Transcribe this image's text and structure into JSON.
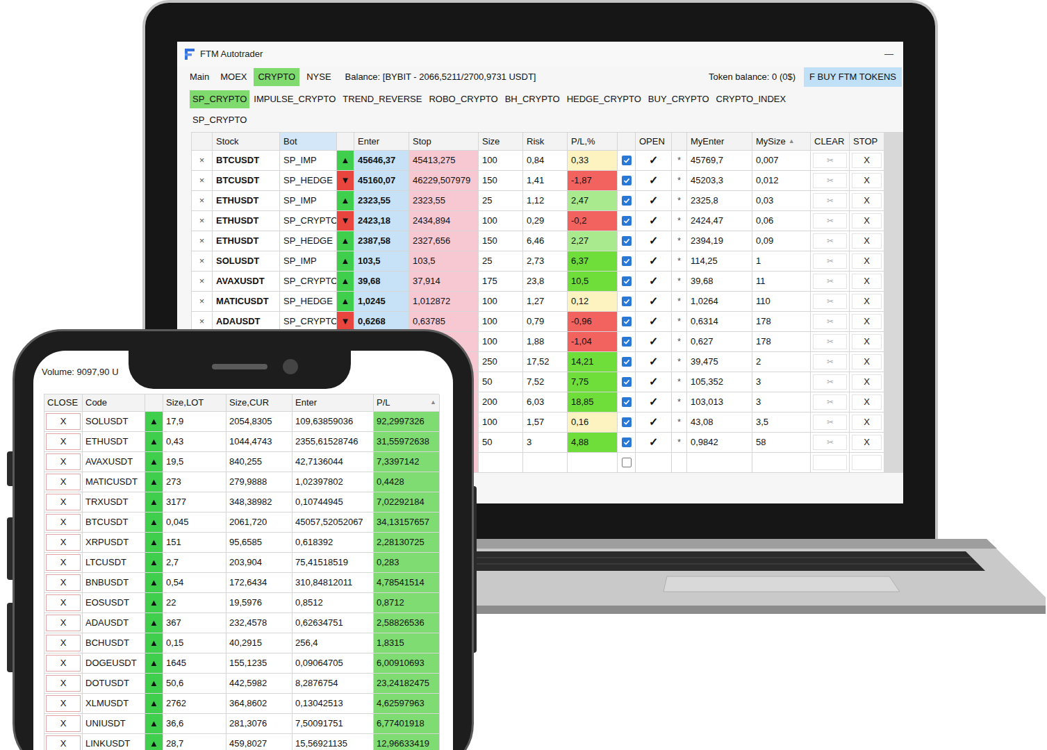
{
  "window": {
    "title": "FTM Autotrader",
    "minimize": "—"
  },
  "menu": [
    {
      "label": "Main",
      "selected": false
    },
    {
      "label": "MOEX",
      "selected": false
    },
    {
      "label": "CRYPTO",
      "selected": true
    },
    {
      "label": "NYSE",
      "selected": false
    }
  ],
  "balance": "Balance: [BYBIT - 2066,5211/2700,9731 USDT]",
  "token_balance": "Token balance: 0 (0$)",
  "buy_button": "F BUY FTM TOKENS",
  "sub_tabs": [
    {
      "label": "SP_CRYPTO",
      "selected": true
    },
    {
      "label": "IMPULSE_CRYPTO",
      "selected": false
    },
    {
      "label": "TREND_REVERSE",
      "selected": false
    },
    {
      "label": "ROBO_CRYPTO",
      "selected": false
    },
    {
      "label": "BH_CRYPTO",
      "selected": false
    },
    {
      "label": "HEDGE_CRYPTO",
      "selected": false
    },
    {
      "label": "BUY_CRYPTO",
      "selected": false
    },
    {
      "label": "CRYPTO_INDEX",
      "selected": false
    }
  ],
  "section_label": "SP_CRYPTO",
  "table": {
    "columns": [
      {
        "label": "",
        "sort": ""
      },
      {
        "label": "Stock",
        "sort": ""
      },
      {
        "label": "Bot",
        "sort": ""
      },
      {
        "label": "",
        "sort": ""
      },
      {
        "label": "Enter",
        "sort": ""
      },
      {
        "label": "Stop",
        "sort": ""
      },
      {
        "label": "Size",
        "sort": ""
      },
      {
        "label": "Risk",
        "sort": ""
      },
      {
        "label": "P/L,%",
        "sort": ""
      },
      {
        "label": "",
        "sort": ""
      },
      {
        "label": "OPEN",
        "sort": ""
      },
      {
        "label": "",
        "sort": ""
      },
      {
        "label": "MyEnter",
        "sort": ""
      },
      {
        "label": "MySize",
        "sort": "▲"
      },
      {
        "label": "CLEAR",
        "sort": ""
      },
      {
        "label": "STOP",
        "sort": ""
      }
    ],
    "rows": [
      {
        "remove": "×",
        "stock": "BTCUSDT",
        "bot": "SP_IMP",
        "arrow": "▲",
        "arrow_color": "#3fcf4c",
        "enter": "45646,37",
        "stop": "45413,275",
        "size": "100",
        "risk": "0,84",
        "pl": "0,33",
        "pl_color": "#fcf3c0",
        "checked": true,
        "open": "✓",
        "star": "*",
        "my_enter": "45769,7",
        "my_size": "0,007",
        "clear": "✂",
        "stop_button": "X"
      },
      {
        "remove": "×",
        "stock": "BTCUSDT",
        "bot": "SP_HEDGE",
        "arrow": "▼",
        "arrow_color": "#e8453f",
        "enter": "45160,07",
        "stop": "46229,507979",
        "size": "150",
        "risk": "1,41",
        "pl": "-1,87",
        "pl_color": "#f2625f",
        "checked": true,
        "open": "✓",
        "star": "*",
        "my_enter": "45203,3",
        "my_size": "0,012",
        "clear": "✂",
        "stop_button": "X"
      },
      {
        "remove": "×",
        "stock": "ETHUSDT",
        "bot": "SP_IMP",
        "arrow": "▲",
        "arrow_color": "#3fcf4c",
        "enter": "2323,55",
        "stop": "2323,55",
        "size": "25",
        "risk": "1,12",
        "pl": "2,47",
        "pl_color": "#a9ea8e",
        "checked": true,
        "open": "✓",
        "star": "*",
        "my_enter": "2325,8",
        "my_size": "0,03",
        "clear": "✂",
        "stop_button": "X"
      },
      {
        "remove": "×",
        "stock": "ETHUSDT",
        "bot": "SP_CRYPTO",
        "arrow": "▼",
        "arrow_color": "#e8453f",
        "enter": "2423,18",
        "stop": "2434,894",
        "size": "100",
        "risk": "0,29",
        "pl": "-0,2",
        "pl_color": "#f2625f",
        "checked": true,
        "open": "✓",
        "star": "*",
        "my_enter": "2424,47",
        "my_size": "0,06",
        "clear": "✂",
        "stop_button": "X"
      },
      {
        "remove": "×",
        "stock": "ETHUSDT",
        "bot": "SP_HEDGE",
        "arrow": "▲",
        "arrow_color": "#3fcf4c",
        "enter": "2387,58",
        "stop": "2327,656",
        "size": "150",
        "risk": "6,46",
        "pl": "2,27",
        "pl_color": "#a9ea8e",
        "checked": true,
        "open": "✓",
        "star": "*",
        "my_enter": "2394,19",
        "my_size": "0,09",
        "clear": "✂",
        "stop_button": "X"
      },
      {
        "remove": "×",
        "stock": "SOLUSDT",
        "bot": "SP_IMP",
        "arrow": "▲",
        "arrow_color": "#3fcf4c",
        "enter": "103,5",
        "stop": "103,5",
        "size": "25",
        "risk": "2,73",
        "pl": "6,37",
        "pl_color": "#6fdd3a",
        "checked": true,
        "open": "✓",
        "star": "*",
        "my_enter": "114,25",
        "my_size": "1",
        "clear": "✂",
        "stop_button": "X"
      },
      {
        "remove": "×",
        "stock": "AVAXUSDT",
        "bot": "SP_CRYPTO",
        "arrow": "▲",
        "arrow_color": "#3fcf4c",
        "enter": "39,68",
        "stop": "37,914",
        "size": "175",
        "risk": "23,8",
        "pl": "10,5",
        "pl_color": "#6fdd3a",
        "checked": true,
        "open": "✓",
        "star": "*",
        "my_enter": "39,68",
        "my_size": "11",
        "clear": "✂",
        "stop_button": "X"
      },
      {
        "remove": "×",
        "stock": "MATICUSDT",
        "bot": "SP_HEDGE",
        "arrow": "▲",
        "arrow_color": "#3fcf4c",
        "enter": "1,0245",
        "stop": "1,012872",
        "size": "100",
        "risk": "1,27",
        "pl": "0,12",
        "pl_color": "#fcf3c0",
        "checked": true,
        "open": "✓",
        "star": "*",
        "my_enter": "1,0264",
        "my_size": "110",
        "clear": "✂",
        "stop_button": "X"
      },
      {
        "remove": "×",
        "stock": "ADAUSDT",
        "bot": "SP_CRYPTO",
        "arrow": "▼",
        "arrow_color": "#e8453f",
        "enter": "0,6268",
        "stop": "0,63785",
        "size": "100",
        "risk": "0,79",
        "pl": "-0,96",
        "pl_color": "#f2625f",
        "checked": true,
        "open": "✓",
        "star": "*",
        "my_enter": "0,6314",
        "my_size": "178",
        "clear": "✂",
        "stop_button": "X"
      },
      {
        "remove": "",
        "stock": "",
        "bot": "",
        "arrow": "",
        "arrow_color": "#ffffff",
        "enter": "",
        "stop": "",
        "size": "100",
        "risk": "1,88",
        "pl": "-1,04",
        "pl_color": "#f2625f",
        "checked": true,
        "open": "✓",
        "star": "*",
        "my_enter": "0,627",
        "my_size": "178",
        "clear": "✂",
        "stop_button": "X"
      },
      {
        "remove": "",
        "stock": "",
        "bot": "",
        "arrow": "",
        "arrow_color": "#ffffff",
        "enter": "",
        "stop": "",
        "size": "250",
        "risk": "17,52",
        "pl": "14,21",
        "pl_color": "#6fdd3a",
        "checked": true,
        "open": "✓",
        "star": "*",
        "my_enter": "39,475",
        "my_size": "2",
        "clear": "✂",
        "stop_button": "X"
      },
      {
        "remove": "",
        "stock": "",
        "bot": "",
        "arrow": "",
        "arrow_color": "#ffffff",
        "enter": "",
        "stop": "",
        "size": "50",
        "risk": "7,52",
        "pl": "7,75",
        "pl_color": "#6fdd3a",
        "checked": true,
        "open": "✓",
        "star": "*",
        "my_enter": "105,352",
        "my_size": "3",
        "clear": "✂",
        "stop_button": "X"
      },
      {
        "remove": "",
        "stock": "",
        "bot": "",
        "arrow": "",
        "arrow_color": "#ffffff",
        "enter": "",
        "stop": "",
        "size": "200",
        "risk": "6,03",
        "pl": "18,85",
        "pl_color": "#6fdd3a",
        "checked": true,
        "open": "✓",
        "star": "*",
        "my_enter": "103,013",
        "my_size": "3",
        "clear": "✂",
        "stop_button": "X"
      },
      {
        "remove": "",
        "stock": "",
        "bot": "",
        "arrow": "",
        "arrow_color": "#ffffff",
        "enter": "",
        "stop": "",
        "size": "100",
        "risk": "1,57",
        "pl": "0,16",
        "pl_color": "#fcf3c0",
        "checked": true,
        "open": "✓",
        "star": "*",
        "my_enter": "43,08",
        "my_size": "3,5",
        "clear": "✂",
        "stop_button": "X"
      },
      {
        "remove": "",
        "stock": "",
        "bot": "",
        "arrow": "",
        "arrow_color": "#ffffff",
        "enter": "",
        "stop": "",
        "size": "50",
        "risk": "3",
        "pl": "4,88",
        "pl_color": "#6fdd3a",
        "checked": true,
        "open": "✓",
        "star": "*",
        "my_enter": "0,9842",
        "my_size": "58",
        "clear": "✂",
        "stop_button": "X"
      },
      {
        "remove": "",
        "stock": "",
        "bot": "",
        "arrow": "",
        "arrow_color": "#ffffff",
        "enter": "",
        "stop": "",
        "size": "",
        "risk": "",
        "pl": "",
        "pl_color": "#ffffff",
        "checked": false,
        "open": "",
        "star": "",
        "my_enter": "",
        "my_size": "",
        "clear": "",
        "stop_button": ""
      }
    ]
  },
  "phone": {
    "volume": "Volume: 9097,90 U",
    "columns": [
      {
        "label": "CLOSE",
        "sort": ""
      },
      {
        "label": "Code",
        "sort": ""
      },
      {
        "label": "",
        "sort": ""
      },
      {
        "label": "Size,LOT",
        "sort": ""
      },
      {
        "label": "Size,CUR",
        "sort": ""
      },
      {
        "label": "Enter",
        "sort": ""
      },
      {
        "label": "P/L",
        "sort": "▲"
      }
    ],
    "rows": [
      {
        "close": "X",
        "code": "SOLUSDT",
        "arrow": "▲",
        "lot": "17,9",
        "cur": "2054,8305",
        "enter": "109,63859036",
        "pl": "92,2997326"
      },
      {
        "close": "X",
        "code": "ETHUSDT",
        "arrow": "▲",
        "lot": "0,43",
        "cur": "1044,4743",
        "enter": "2355,61528746",
        "pl": "31,55972638"
      },
      {
        "close": "X",
        "code": "AVAXUSDT",
        "arrow": "▲",
        "lot": "19,5",
        "cur": "840,255",
        "enter": "42,7136044",
        "pl": "7,3397142"
      },
      {
        "close": "X",
        "code": "MATICUSDT",
        "arrow": "▲",
        "lot": "273",
        "cur": "279,9888",
        "enter": "1,02397802",
        "pl": "0,4428"
      },
      {
        "close": "X",
        "code": "TRXUSDT",
        "arrow": "▲",
        "lot": "3177",
        "cur": "348,38982",
        "enter": "0,10744945",
        "pl": "7,02292184"
      },
      {
        "close": "X",
        "code": "BTCUSDT",
        "arrow": "▲",
        "lot": "0,045",
        "cur": "2061,720",
        "enter": "45057,52052067",
        "pl": "34,13157657"
      },
      {
        "close": "X",
        "code": "XRPUSDT",
        "arrow": "▲",
        "lot": "151",
        "cur": "95,6585",
        "enter": "0,618392",
        "pl": "2,28130725"
      },
      {
        "close": "X",
        "code": "LTCUSDT",
        "arrow": "▲",
        "lot": "2,7",
        "cur": "203,904",
        "enter": "75,41518519",
        "pl": "0,283"
      },
      {
        "close": "X",
        "code": "BNBUSDT",
        "arrow": "▲",
        "lot": "0,54",
        "cur": "172,6434",
        "enter": "310,84812011",
        "pl": "4,78541514"
      },
      {
        "close": "X",
        "code": "EOSUSDT",
        "arrow": "▲",
        "lot": "22",
        "cur": "19,5976",
        "enter": "0,8512",
        "pl": "0,8712"
      },
      {
        "close": "X",
        "code": "ADAUSDT",
        "arrow": "▲",
        "lot": "367",
        "cur": "232,4578",
        "enter": "0,62634751",
        "pl": "2,58826536"
      },
      {
        "close": "X",
        "code": "BCHUSDT",
        "arrow": "▲",
        "lot": "0,15",
        "cur": "40,2915",
        "enter": "256,4",
        "pl": "1,8315"
      },
      {
        "close": "X",
        "code": "DOGEUSDT",
        "arrow": "▲",
        "lot": "1645",
        "cur": "155,1235",
        "enter": "0,09064705",
        "pl": "6,00910693"
      },
      {
        "close": "X",
        "code": "DOTUSDT",
        "arrow": "▲",
        "lot": "50,6",
        "cur": "442,5982",
        "enter": "8,2876754",
        "pl": "23,24182475"
      },
      {
        "close": "X",
        "code": "XLMUSDT",
        "arrow": "▲",
        "lot": "2762",
        "cur": "364,8602",
        "enter": "0,13042513",
        "pl": "4,62597963"
      },
      {
        "close": "X",
        "code": "UNIUSDT",
        "arrow": "▲",
        "lot": "36,6",
        "cur": "281,3076",
        "enter": "7,50091751",
        "pl": "6,77401918"
      },
      {
        "close": "X",
        "code": "LINKUSDT",
        "arrow": "▲",
        "lot": "28,7",
        "cur": "459,8027",
        "enter": "15,56921135",
        "pl": "12,96633419"
      }
    ]
  }
}
